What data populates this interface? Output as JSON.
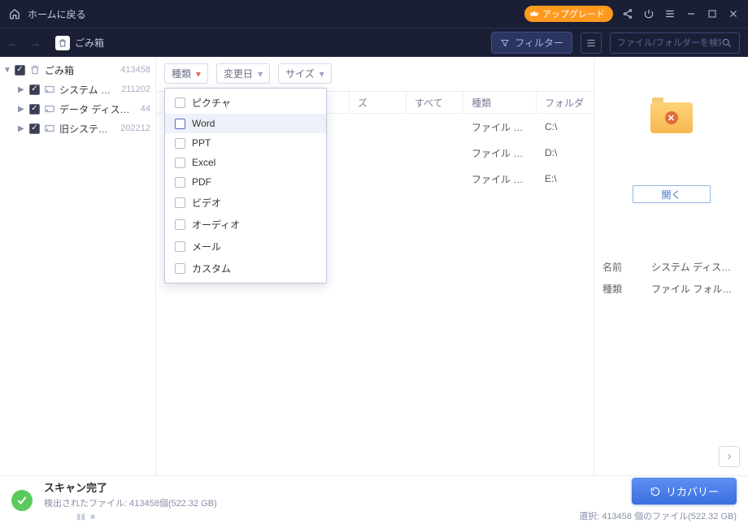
{
  "titlebar": {
    "home_label": "ホームに戻る",
    "upgrade_label": "アップグレード"
  },
  "toolbar": {
    "location_label": "ごみ箱",
    "filter_label": "フィルター",
    "search_placeholder": "ファイル/フォルダーを検索"
  },
  "sidebar": {
    "root": {
      "label": "ごみ箱",
      "count": "413458"
    },
    "items": [
      {
        "label": "システム ディスク (C:) N...",
        "count": "211202"
      },
      {
        "label": "データ ディスク (D:) NTFS",
        "count": "44"
      },
      {
        "label": "旧システム (E:) NTFS",
        "count": "202212"
      }
    ]
  },
  "filters": {
    "type_label": "種類",
    "date_label": "変更日",
    "size_label": "サイズ",
    "type_options": [
      "ピクチャ",
      "Word",
      "PPT",
      "Excel",
      "PDF",
      "ビデオ",
      "オーディオ",
      "メール",
      "カスタム"
    ]
  },
  "columns": {
    "name": "",
    "size": "ズ",
    "date": "すべて",
    "type": "種類",
    "folder": "フォルダ"
  },
  "rows": [
    {
      "type": "ファイル フォ...",
      "folder": "C:\\"
    },
    {
      "type": "ファイル フォ...",
      "folder": "D:\\"
    },
    {
      "type": "ファイル フォ...",
      "folder": "E:\\"
    }
  ],
  "rightpane": {
    "open_label": "開く",
    "name_key": "名前",
    "name_val": "システム ディスク (C:) ..",
    "type_key": "種類",
    "type_val": "ファイル フォルダー"
  },
  "status": {
    "title": "スキャン完了",
    "detected": "検出されたファイル: 413458個(522.32 GB)",
    "recover_label": "リカバリー",
    "selection": "選択: 413458 個のファイル(522.32 GB)"
  }
}
